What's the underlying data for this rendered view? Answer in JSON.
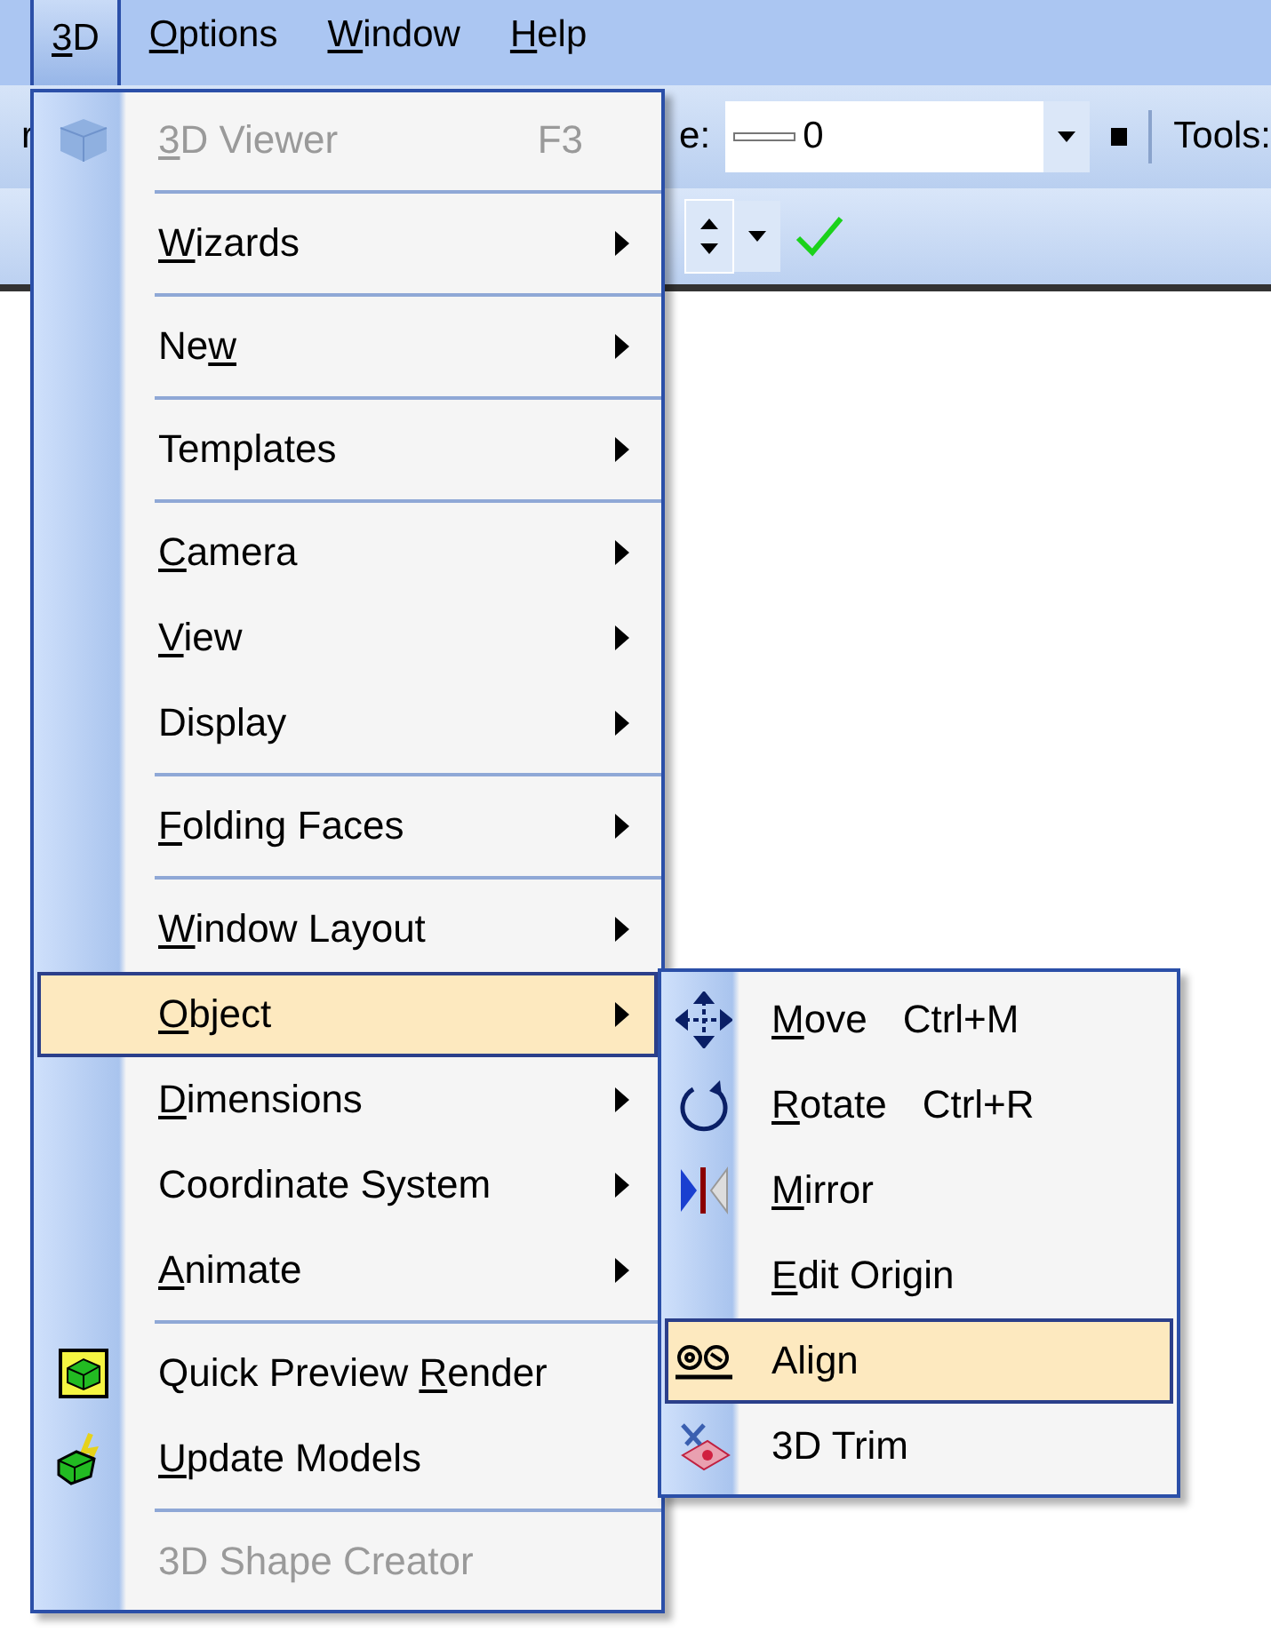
{
  "menu_bar": [
    {
      "label": {
        "key": "3",
        "post": "D"
      },
      "selected": true
    },
    {
      "label": {
        "key": "O",
        "post": "ptions"
      },
      "selected": false
    },
    {
      "label": {
        "key": "W",
        "post": "indow"
      },
      "selected": false
    },
    {
      "label": {
        "key": "H",
        "post": "elp"
      },
      "selected": false
    }
  ],
  "toolbar": {
    "cut_label_left": "r",
    "style_label": "e:",
    "style_value": "0",
    "tools_label": "Tools:"
  },
  "menu": [
    {
      "kind": "item",
      "label": {
        "key": "3",
        "post": "D Viewer"
      },
      "shortcut": "F3",
      "submenu": false,
      "disabled": true,
      "selected": false
    },
    {
      "kind": "separator"
    },
    {
      "kind": "item",
      "label": {
        "key": "W",
        "post": "izards"
      },
      "submenu": true,
      "disabled": false,
      "selected": false
    },
    {
      "kind": "separator"
    },
    {
      "kind": "item",
      "label": {
        "pre": "Ne",
        "key": "w"
      },
      "submenu": true,
      "disabled": false,
      "selected": false
    },
    {
      "kind": "separator"
    },
    {
      "kind": "item",
      "label": {
        "pre": "Templates"
      },
      "submenu": true,
      "disabled": false,
      "selected": false
    },
    {
      "kind": "separator"
    },
    {
      "kind": "item",
      "label": {
        "key": "C",
        "post": "amera"
      },
      "submenu": true,
      "disabled": false,
      "selected": false
    },
    {
      "kind": "item",
      "label": {
        "key": "V",
        "post": "iew"
      },
      "submenu": true,
      "disabled": false,
      "selected": false
    },
    {
      "kind": "item",
      "label": {
        "pre": "Display"
      },
      "submenu": true,
      "disabled": false,
      "selected": false
    },
    {
      "kind": "separator"
    },
    {
      "kind": "item",
      "label": {
        "key": "F",
        "post": "olding Faces"
      },
      "submenu": true,
      "disabled": false,
      "selected": false
    },
    {
      "kind": "separator"
    },
    {
      "kind": "item",
      "label": {
        "key": "W",
        "post": "indow Layout"
      },
      "submenu": true,
      "disabled": false,
      "selected": false
    },
    {
      "kind": "item",
      "label": {
        "key": "O",
        "post": "bject"
      },
      "submenu": true,
      "disabled": false,
      "selected": true
    },
    {
      "kind": "item",
      "label": {
        "key": "D",
        "post": "imensions"
      },
      "submenu": true,
      "disabled": false,
      "selected": false
    },
    {
      "kind": "item",
      "label": {
        "pre": "Coordinate System"
      },
      "submenu": true,
      "disabled": false,
      "selected": false
    },
    {
      "kind": "item",
      "label": {
        "key": "A",
        "post": "nimate"
      },
      "submenu": true,
      "disabled": false,
      "selected": false
    },
    {
      "kind": "separator"
    },
    {
      "kind": "item",
      "label": {
        "pre": "Quick Preview ",
        "key": "R",
        "post": "ender"
      },
      "submenu": false,
      "disabled": false,
      "selected": false
    },
    {
      "kind": "item",
      "label": {
        "key": "U",
        "post": "pdate Models"
      },
      "submenu": false,
      "disabled": false,
      "selected": false
    },
    {
      "kind": "separator"
    },
    {
      "kind": "item",
      "label": {
        "pre": "3D Shape Creator"
      },
      "submenu": false,
      "disabled": true,
      "selected": false
    }
  ],
  "submenu": [
    {
      "label": {
        "key": "M",
        "post": "ove"
      },
      "shortcut": "Ctrl+M",
      "selected": false
    },
    {
      "label": {
        "key": "R",
        "post": "otate"
      },
      "shortcut": "Ctrl+R",
      "selected": false
    },
    {
      "label": {
        "key": "M",
        "post": "irror"
      },
      "selected": false
    },
    {
      "label": {
        "key": "E",
        "post": "dit Origin"
      },
      "selected": false
    },
    {
      "label": {
        "pre": "Align"
      },
      "selected": true
    },
    {
      "label": {
        "pre": "3D Trim"
      },
      "selected": false
    }
  ]
}
